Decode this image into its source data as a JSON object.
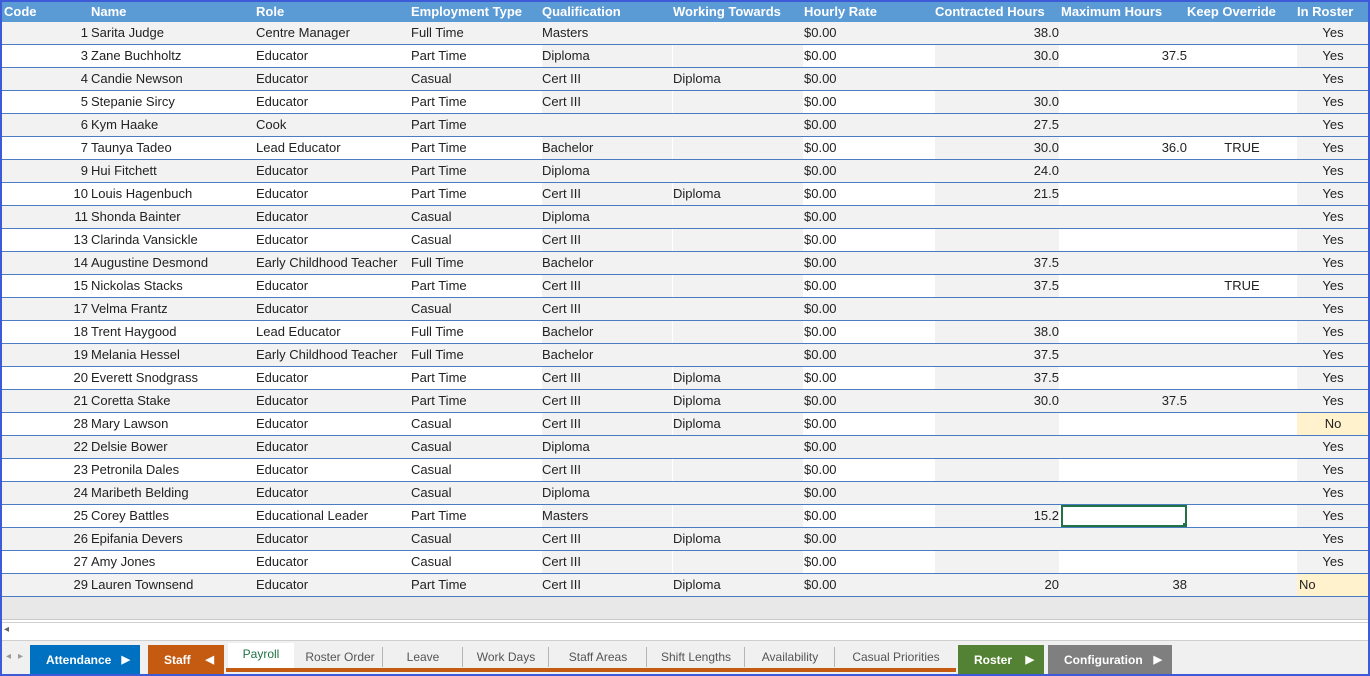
{
  "headers": {
    "code": "Code",
    "name": "Name",
    "role": "Role",
    "employment_type": "Employment Type",
    "qualification": "Qualification",
    "working_towards": "Working Towards",
    "hourly_rate": "Hourly Rate",
    "contracted_hours": "Contracted Hours",
    "maximum_hours": "Maximum Hours",
    "keep_override": "Keep Override",
    "in_roster": "In Roster"
  },
  "rows": [
    {
      "code": "1",
      "name": "Sarita Judge",
      "role": "Centre Manager",
      "emp": "Full Time",
      "qual": "Masters",
      "towards": "",
      "rate": "$0.00",
      "contracted": "38.0",
      "max": "",
      "override": "",
      "roster": "Yes"
    },
    {
      "code": "3",
      "name": "Zane Buchholtz",
      "role": "Educator",
      "emp": "Part Time",
      "qual": "Diploma",
      "towards": "",
      "rate": "$0.00",
      "contracted": "30.0",
      "max": "37.5",
      "override": "",
      "roster": "Yes"
    },
    {
      "code": "4",
      "name": "Candie Newson",
      "role": "Educator",
      "emp": "Casual",
      "qual": "Cert III",
      "towards": "Diploma",
      "rate": "$0.00",
      "contracted": "",
      "max": "",
      "override": "",
      "roster": "Yes"
    },
    {
      "code": "5",
      "name": "Stepanie Sircy",
      "role": "Educator",
      "emp": "Part Time",
      "qual": "Cert III",
      "towards": "",
      "rate": "$0.00",
      "contracted": "30.0",
      "max": "",
      "override": "",
      "roster": "Yes"
    },
    {
      "code": "6",
      "name": "Kym Haake",
      "role": "Cook",
      "emp": "Part Time",
      "qual": "",
      "towards": "",
      "rate": "$0.00",
      "contracted": "27.5",
      "max": "",
      "override": "",
      "roster": "Yes"
    },
    {
      "code": "7",
      "name": "Taunya Tadeo",
      "role": "Lead Educator",
      "emp": "Part Time",
      "qual": "Bachelor",
      "towards": "",
      "rate": "$0.00",
      "contracted": "30.0",
      "max": "36.0",
      "override": "TRUE",
      "roster": "Yes"
    },
    {
      "code": "9",
      "name": "Hui Fitchett",
      "role": "Educator",
      "emp": "Part Time",
      "qual": "Diploma",
      "towards": "",
      "rate": "$0.00",
      "contracted": "24.0",
      "max": "",
      "override": "",
      "roster": "Yes"
    },
    {
      "code": "10",
      "name": "Louis Hagenbuch",
      "role": "Educator",
      "emp": "Part Time",
      "qual": "Cert III",
      "towards": "Diploma",
      "rate": "$0.00",
      "contracted": "21.5",
      "max": "",
      "override": "",
      "roster": "Yes"
    },
    {
      "code": "11",
      "name": "Shonda Bainter",
      "role": "Educator",
      "emp": "Casual",
      "qual": "Diploma",
      "towards": "",
      "rate": "$0.00",
      "contracted": "",
      "max": "",
      "override": "",
      "roster": "Yes"
    },
    {
      "code": "13",
      "name": "Clarinda Vansickle",
      "role": "Educator",
      "emp": "Casual",
      "qual": "Cert III",
      "towards": "",
      "rate": "$0.00",
      "contracted": "",
      "max": "",
      "override": "",
      "roster": "Yes"
    },
    {
      "code": "14",
      "name": "Augustine Desmond",
      "role": "Early Childhood Teacher",
      "emp": "Full Time",
      "qual": "Bachelor",
      "towards": "",
      "rate": "$0.00",
      "contracted": "37.5",
      "max": "",
      "override": "",
      "roster": "Yes"
    },
    {
      "code": "15",
      "name": "Nickolas Stacks",
      "role": "Educator",
      "emp": "Part Time",
      "qual": "Cert III",
      "towards": "",
      "rate": "$0.00",
      "contracted": "37.5",
      "max": "",
      "override": "TRUE",
      "roster": "Yes"
    },
    {
      "code": "17",
      "name": "Velma Frantz",
      "role": "Educator",
      "emp": "Casual",
      "qual": "Cert III",
      "towards": "",
      "rate": "$0.00",
      "contracted": "",
      "max": "",
      "override": "",
      "roster": "Yes"
    },
    {
      "code": "18",
      "name": "Trent Haygood",
      "role": "Lead Educator",
      "emp": "Full Time",
      "qual": "Bachelor",
      "towards": "",
      "rate": "$0.00",
      "contracted": "38.0",
      "max": "",
      "override": "",
      "roster": "Yes"
    },
    {
      "code": "19",
      "name": "Melania Hessel",
      "role": "Early Childhood Teacher",
      "emp": "Full Time",
      "qual": "Bachelor",
      "towards": "",
      "rate": "$0.00",
      "contracted": "37.5",
      "max": "",
      "override": "",
      "roster": "Yes"
    },
    {
      "code": "20",
      "name": "Everett Snodgrass",
      "role": "Educator",
      "emp": "Part Time",
      "qual": "Cert III",
      "towards": "Diploma",
      "rate": "$0.00",
      "contracted": "37.5",
      "max": "",
      "override": "",
      "roster": "Yes"
    },
    {
      "code": "21",
      "name": "Coretta Stake",
      "role": "Educator",
      "emp": "Part Time",
      "qual": "Cert III",
      "towards": "Diploma",
      "rate": "$0.00",
      "contracted": "30.0",
      "max": "37.5",
      "override": "",
      "roster": "Yes"
    },
    {
      "code": "28",
      "name": "Mary Lawson",
      "role": "Educator",
      "emp": "Casual",
      "qual": "Cert III",
      "towards": "Diploma",
      "rate": "$0.00",
      "contracted": "",
      "max": "",
      "override": "",
      "roster": "No"
    },
    {
      "code": "22",
      "name": "Delsie Bower",
      "role": "Educator",
      "emp": "Casual",
      "qual": "Diploma",
      "towards": "",
      "rate": "$0.00",
      "contracted": "",
      "max": "",
      "override": "",
      "roster": "Yes"
    },
    {
      "code": "23",
      "name": "Petronila Dales",
      "role": "Educator",
      "emp": "Casual",
      "qual": "Cert III",
      "towards": "",
      "rate": "$0.00",
      "contracted": "",
      "max": "",
      "override": "",
      "roster": "Yes"
    },
    {
      "code": "24",
      "name": "Maribeth Belding",
      "role": "Educator",
      "emp": "Casual",
      "qual": "Diploma",
      "towards": "",
      "rate": "$0.00",
      "contracted": "",
      "max": "",
      "override": "",
      "roster": "Yes"
    },
    {
      "code": "25",
      "name": "Corey Battles",
      "role": "Educational Leader",
      "emp": "Part Time",
      "qual": "Masters",
      "towards": "",
      "rate": "$0.00",
      "contracted": "15.2",
      "max": "",
      "override": "",
      "roster": "Yes"
    },
    {
      "code": "26",
      "name": "Epifania Devers",
      "role": "Educator",
      "emp": "Casual",
      "qual": "Cert III",
      "towards": "Diploma",
      "rate": "$0.00",
      "contracted": "",
      "max": "",
      "override": "",
      "roster": "Yes"
    },
    {
      "code": "27",
      "name": "Amy Jones",
      "role": "Educator",
      "emp": "Casual",
      "qual": "Cert III",
      "towards": "",
      "rate": "$0.00",
      "contracted": "",
      "max": "",
      "override": "",
      "roster": "Yes"
    },
    {
      "code": "29",
      "name": "Lauren Townsend",
      "role": "Educator",
      "emp": "Part Time",
      "qual": "Cert III",
      "towards": "Diploma",
      "rate": "$0.00",
      "contracted": "20",
      "max": "38",
      "override": "",
      "roster": "No"
    }
  ],
  "tabs": {
    "attendance": "Attendance",
    "staff": "Staff",
    "payroll": "Payroll",
    "roster_order": "Roster Order",
    "leave": "Leave",
    "work_days": "Work Days",
    "staff_areas": "Staff Areas",
    "shift_lengths": "Shift Lengths",
    "availability": "Availability",
    "casual_priorities": "Casual Priorities",
    "roster": "Roster",
    "configuration": "Configuration"
  },
  "colors": {
    "header_bg": "#5b9bd5",
    "attendance_btn": "#0070c0",
    "staff_btn": "#c55a11",
    "roster_btn": "#548235",
    "configuration_btn": "#7f7f7f",
    "no_highlight": "#fff2cc"
  },
  "icons": {
    "nav_arrow_right": "triangle-right",
    "nav_arrow_left": "triangle-left"
  }
}
